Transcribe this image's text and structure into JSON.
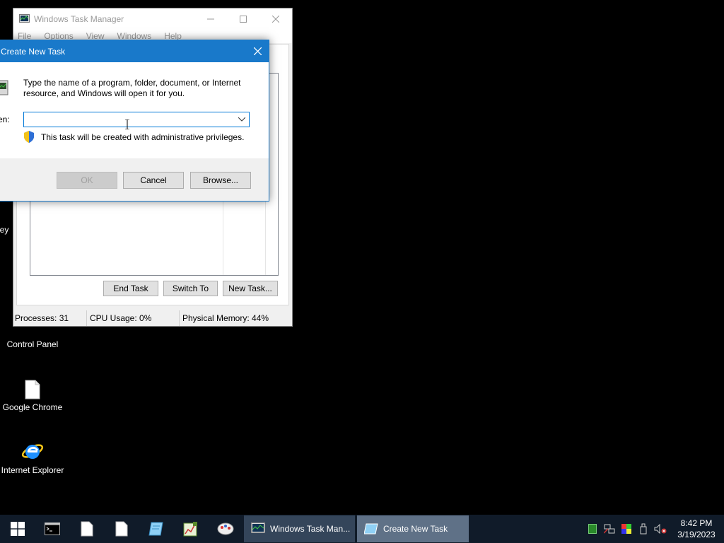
{
  "desktop": {
    "icons": [
      {
        "label": "Key",
        "icon": "partial-icon"
      },
      {
        "label": "Control Panel",
        "icon": "control-panel-icon"
      },
      {
        "label": "Google Chrome",
        "icon": "blank-document-icon"
      },
      {
        "label": "Internet Explorer",
        "icon": "internet-explorer-icon"
      }
    ]
  },
  "task_manager": {
    "title": "Windows Task Manager",
    "menu": [
      "File",
      "Options",
      "View",
      "Windows",
      "Help"
    ],
    "buttons": {
      "end_task": "End Task",
      "switch_to": "Switch To",
      "new_task": "New Task..."
    },
    "status": {
      "processes": "Processes: 31",
      "cpu": "CPU Usage: 0%",
      "memory": "Physical Memory: 44%"
    }
  },
  "dialog": {
    "title": "Create New Task",
    "description": "Type the name of a program, folder, document, or Internet resource, and Windows will open it for you.",
    "open_label": "en:",
    "open_value": "",
    "admin_note": "This task will be created with administrative privileges.",
    "buttons": {
      "ok": "OK",
      "cancel": "Cancel",
      "browse": "Browse..."
    }
  },
  "taskbar": {
    "pinned": [
      "start-icon",
      "command-prompt-icon",
      "document-icon",
      "document-icon",
      "notepad-icon",
      "spreadsheet-icon",
      "paint-icon"
    ],
    "tasks": [
      {
        "label": "Windows Task Man...",
        "state": "inactive"
      },
      {
        "label": "Create New Task",
        "state": "active"
      }
    ],
    "clock": {
      "time": "8:42 PM",
      "date": "3/19/2023"
    }
  },
  "colors": {
    "title_blue": "#1979ca",
    "taskbar": "#101b29"
  }
}
